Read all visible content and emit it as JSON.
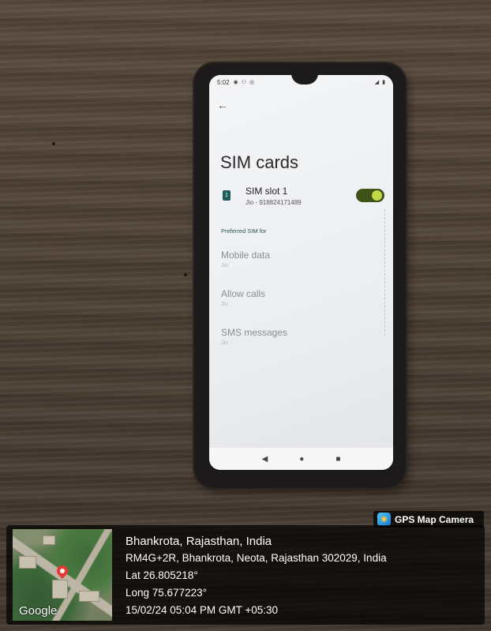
{
  "phone": {
    "status_time": "5:02",
    "title": "SIM cards",
    "sim_slot": {
      "icon_text": "1",
      "label": "SIM slot 1",
      "carrier": "Jio - 918824171489",
      "enabled": true
    },
    "section_header": "Preferred SIM for",
    "preferences": [
      {
        "label": "Mobile data",
        "value": "Jio"
      },
      {
        "label": "Allow calls",
        "value": "Jio"
      },
      {
        "label": "SMS messages",
        "value": "Jio"
      }
    ],
    "icons": {
      "back": "back-arrow-icon",
      "nav_back": "nav-back-icon",
      "nav_home": "nav-home-icon",
      "nav_recents": "nav-recents-icon"
    },
    "colors": {
      "toggle_track": "#3e5318",
      "toggle_knob": "#c5d84a",
      "sim_icon": "#1e5d5b"
    }
  },
  "gps": {
    "badge_label": "GPS Map Camera",
    "map_logo": "Google",
    "location_title": "Bhankrota, Rajasthan, India",
    "address": "RM4G+2R, Bhankrota, Neota, Rajasthan 302029, India",
    "lat": "Lat 26.805218°",
    "long": "Long 75.677223°",
    "datetime": "15/02/24 05:04 PM GMT +05:30"
  }
}
